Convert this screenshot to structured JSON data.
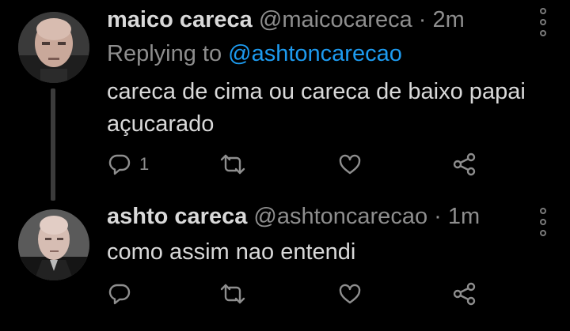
{
  "tweets": [
    {
      "name": "maico careca",
      "handle": "@maicocareca",
      "separator": "·",
      "time": "2m",
      "replying_prefix": "Replying to",
      "replying_to": "@ashtoncarecao",
      "text": "careca de cima ou careca de baixo papai açucarado",
      "reply_count": "1",
      "icons": [
        "reply-icon",
        "retweet-icon",
        "like-icon",
        "share-icon",
        "more-icon"
      ]
    },
    {
      "name": "ashto careca",
      "handle": "@ashtoncarecao",
      "separator": "·",
      "time": "1m",
      "text": "como assim nao entendi",
      "reply_count": "",
      "icons": [
        "reply-icon",
        "retweet-icon",
        "like-icon",
        "share-icon",
        "more-icon"
      ]
    }
  ],
  "colors": {
    "background": "#000000",
    "text": "#d9d9d9",
    "secondary": "#8e8e8e",
    "link": "#1d9bf0"
  }
}
